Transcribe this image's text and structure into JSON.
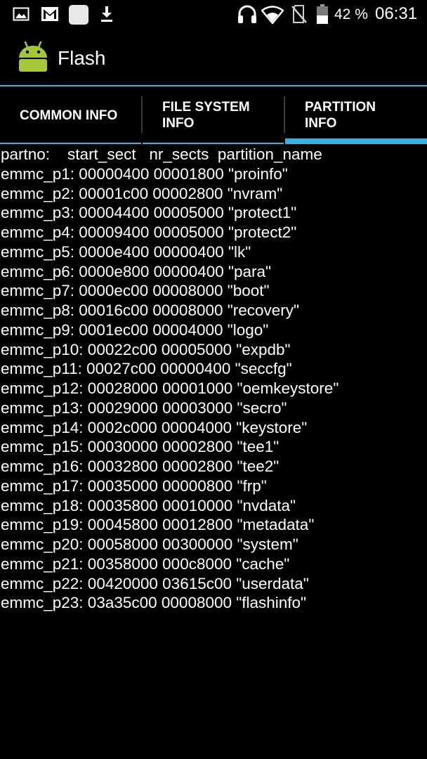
{
  "status_bar": {
    "icons_left": [
      "image-icon",
      "gmail-icon",
      "blank-square-icon",
      "download-icon"
    ],
    "icons_right": [
      "headset-icon",
      "wifi-icon",
      "no-sim-icon",
      "battery-icon"
    ],
    "battery_percent": "42 %",
    "time": "06:31"
  },
  "action_bar": {
    "app_icon": "android-icon",
    "title": "Flash"
  },
  "tabs": [
    {
      "line1": "COMMON INFO",
      "line2": "",
      "selected": false
    },
    {
      "line1": "FILE SYSTEM",
      "line2": "INFO",
      "selected": false
    },
    {
      "line1": "PARTITION",
      "line2": "INFO",
      "selected": true
    }
  ],
  "partition_table": {
    "header": "partno:    start_sect   nr_sects  partition_name",
    "rows": [
      "emmc_p1: 00000400 00001800 \"proinfo\"",
      "emmc_p2: 00001c00 00002800 \"nvram\"",
      "emmc_p3: 00004400 00005000 \"protect1\"",
      "emmc_p4: 00009400 00005000 \"protect2\"",
      "emmc_p5: 0000e400 00000400 \"lk\"",
      "emmc_p6: 0000e800 00000400 \"para\"",
      "emmc_p7: 0000ec00 00008000 \"boot\"",
      "emmc_p8: 00016c00 00008000 \"recovery\"",
      "emmc_p9: 0001ec00 00004000 \"logo\"",
      "emmc_p10: 00022c00 00005000 \"expdb\"",
      "emmc_p11: 00027c00 00000400 \"seccfg\"",
      "emmc_p12: 00028000 00001000 \"oemkeystore\"",
      "emmc_p13: 00029000 00003000 \"secro\"",
      "emmc_p14: 0002c000 00004000 \"keystore\"",
      "emmc_p15: 00030000 00002800 \"tee1\"",
      "emmc_p16: 00032800 00002800 \"tee2\"",
      "emmc_p17: 00035000 00000800 \"frp\"",
      "emmc_p18: 00035800 00010000 \"nvdata\"",
      "emmc_p19: 00045800 00012800 \"metadata\"",
      "emmc_p20: 00058000 00300000 \"system\"",
      "emmc_p21: 00358000 000c8000 \"cache\"",
      "emmc_p22: 00420000 03615c00 \"userdata\"",
      "emmc_p23: 03a35c00 00008000 \"flashinfo\""
    ]
  },
  "colors": {
    "background": "#000000",
    "text": "#ffffff",
    "accent": "#33b5e5",
    "android_green": "#a4c639"
  }
}
